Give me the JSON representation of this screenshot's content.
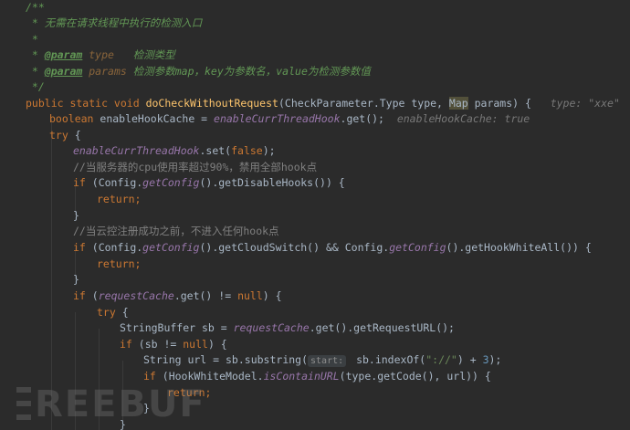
{
  "code": {
    "l1": {
      "t": "/**"
    },
    "l2": {
      "t": " * 无需在请求线程中执行的检测入口"
    },
    "l3": {
      "t": " *"
    },
    "l4": {
      "a": " * ",
      "tag": "@param",
      "name": " type",
      "desc": "   检测类型"
    },
    "l5": {
      "a": " * ",
      "tag": "@param",
      "name": " params",
      "desc": " 检测参数map，key为参数名，value为检测参数值"
    },
    "l6": {
      "t": " */"
    },
    "l7": {
      "kw1": "public static void ",
      "fn": "doCheckWithoutRequest",
      "p1": "(CheckParameter.Type type, ",
      "map": "Map",
      "p2": " params) {",
      "hint": "   type: \"xxe\"    params"
    },
    "l8": {
      "kw": "boolean",
      "p1": " enableHookCache = ",
      "f": "enableCurrThreadHook",
      "p2": ".get();",
      "hint": "  enableHookCache: true"
    },
    "l9": {
      "kw": "try",
      "p": " {"
    },
    "l10": {
      "f": "enableCurrThreadHook",
      "p1": ".set(",
      "kw": "false",
      "p2": ");"
    },
    "l11": {
      "t": "//当服务器的cpu使用率超过90%，禁用全部hook点"
    },
    "l12": {
      "kw": "if",
      "p1": " (Config.",
      "f": "getConfig",
      "p2": "().getDisableHooks()) {"
    },
    "l13": {
      "kw": "return",
      "p": ";"
    },
    "l14": {
      "p": "}"
    },
    "l15": {
      "t": "//当云控注册成功之前，不进入任何hook点"
    },
    "l16": {
      "kw": "if",
      "p1": " (Config.",
      "f1": "getConfig",
      "p2": "().getCloudSwitch() && Config.",
      "f2": "getConfig",
      "p3": "().getHookWhiteAll()) {"
    },
    "l17": {
      "kw": "return",
      "p": ";"
    },
    "l18": {
      "p": "}"
    },
    "l19": {
      "kw": "if",
      "p1": " (",
      "f": "requestCache",
      "p2": ".get() != ",
      "kw2": "null",
      "p3": ") {"
    },
    "l20": {
      "kw": "try",
      "p": " {"
    },
    "l21": {
      "p1": "StringBuffer sb = ",
      "f": "requestCache",
      "p2": ".get().getRequestURL();"
    },
    "l22": {
      "kw": "if",
      "p1": " (sb != ",
      "kw2": "null",
      "p2": ") {"
    },
    "l23": {
      "p1": "String url = sb.substring(",
      "chip": "start:",
      "p2": " sb.indexOf(",
      "str": "\"://\"",
      "p3": ") + ",
      "num": "3",
      "p4": ");"
    },
    "l24": {
      "kw": "if",
      "p1": " (HookWhiteModel.",
      "f": "isContainURL",
      "p2": "(type.getCode(), url)) {"
    },
    "l25": {
      "kw": "return",
      "p": ";"
    },
    "l26": {
      "p": "}"
    },
    "l27": {
      "p": "}"
    }
  },
  "watermark": {
    "text": "REEBUF"
  },
  "colors": {
    "background": "#2b2b2b",
    "keyword": "#cc7832",
    "method": "#ffc66d",
    "field": "#9876aa",
    "comment": "#808080",
    "doc": "#629755"
  }
}
